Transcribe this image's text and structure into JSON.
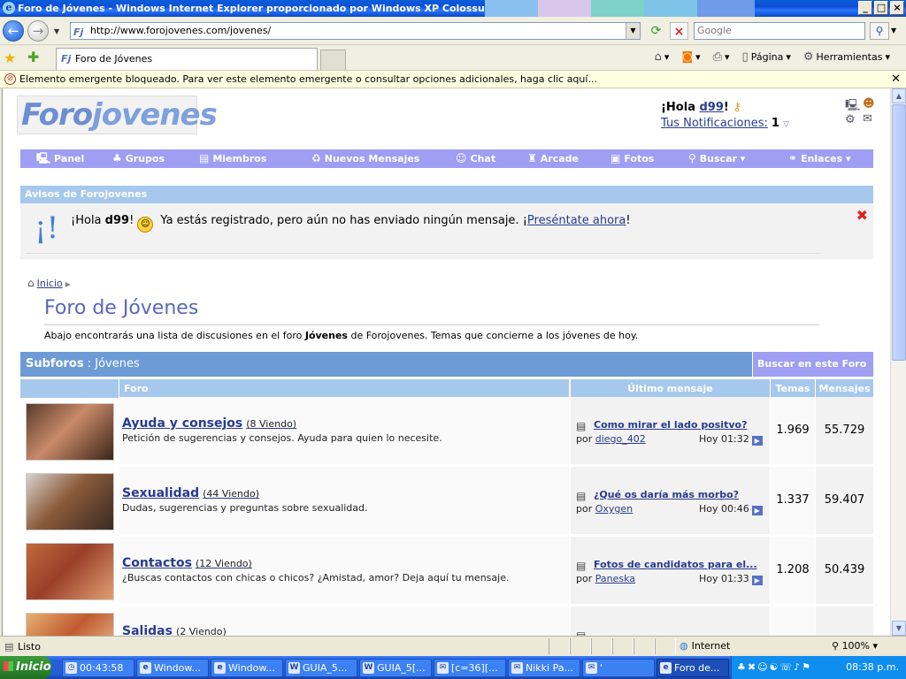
{
  "window": {
    "title": "Foro de Jóvenes - Windows Internet Explorer proporcionado por Windows XP Colossus Ed.",
    "controls": [
      "_",
      "□",
      "×"
    ]
  },
  "browser": {
    "url": "http://www.forojovenes.com/jovenes/",
    "search_placeholder": "Google",
    "tab_title": "Foro de Jóvenes",
    "tools": {
      "page": "Página",
      "tools": "Herramientas"
    },
    "infobar": "Elemento emergente bloqueado. Para ver este elemento emergente o consultar opciones adicionales, haga clic aquí..."
  },
  "site": {
    "logo_a": "Foro",
    "logo_b": "jovenes",
    "greeting_prefix": "¡Hola ",
    "username": "d99",
    "greeting_suffix": "!",
    "notifications_label": "Tus Notificaciones:",
    "notifications_count": "1",
    "nav": [
      {
        "label": "Panel",
        "icon": "monitor-icon",
        "glyph": "🖳"
      },
      {
        "label": "Grupos",
        "icon": "group-icon",
        "glyph": "♣"
      },
      {
        "label": "Miembros",
        "icon": "members-icon",
        "glyph": "▤"
      },
      {
        "label": "Nuevos Mensajes",
        "icon": "new-messages-icon",
        "glyph": "♻"
      },
      {
        "label": "Chat",
        "icon": "chat-icon",
        "glyph": "☺"
      },
      {
        "label": "Arcade",
        "icon": "arcade-icon",
        "glyph": "♜"
      },
      {
        "label": "Fotos",
        "icon": "camera-icon",
        "glyph": "▣"
      },
      {
        "label": "Buscar ▾",
        "icon": "search-icon",
        "glyph": "⚲"
      },
      {
        "label": "Enlaces ▾",
        "icon": "link-icon",
        "glyph": "⚭"
      }
    ],
    "notice_header": "Avisos de Forojovenes",
    "notice": {
      "hello": "¡Hola ",
      "user": "d99",
      "after_user": "!",
      "text": " Ya estás registrado, pero aún no has enviado ningún mensaje. ¡",
      "link": "Preséntate ahora",
      "end": "!"
    },
    "breadcrumb": "Inicio",
    "forum_title": "Foro de Jóvenes",
    "forum_desc_pre": "Abajo encontrarás una lista de discusiones en el foro ",
    "forum_desc_bold": "Jóvenes",
    "forum_desc_post": " de Forojovenes. Temas que concierne a los jóvenes de hoy.",
    "subforos_label": "Subforos",
    "subforos_sep": " : ",
    "subforos_name": "Jóvenes",
    "search_forum": "Buscar en este Foro ▾",
    "columns": {
      "forum": "Foro",
      "last": "Último mensaje",
      "topics": "Temas",
      "posts": "Mensajes"
    },
    "forums": [
      {
        "name": "Ayuda y consejos",
        "viewing": "(8 Viendo)",
        "desc": "Petición de sugerencias y consejos. Ayuda para quien lo necesite.",
        "last_title": "Como mirar el lado positvo?",
        "by": "por ",
        "author": "diego_402",
        "when": "Hoy 01:32",
        "topics": "1.969",
        "posts": "55.729",
        "thumb": [
          "#5a3b2a",
          "#c98a6a",
          "#3b2418"
        ]
      },
      {
        "name": "Sexualidad",
        "viewing": "(44 Viendo)",
        "desc": "Dudas, sugerencias y preguntas sobre sexualidad.",
        "last_title": "¿Qué os daría más morbo?",
        "by": "por ",
        "author": "Oxygen",
        "when": "Hoy 00:46",
        "topics": "1.337",
        "posts": "59.407",
        "thumb": [
          "#d8d2cc",
          "#8a5a3a",
          "#3a2a22"
        ]
      },
      {
        "name": "Contactos",
        "viewing": "(12 Viendo)",
        "desc": "¿Buscas contactos con chicas o chicos? ¿Amistad, amor? Deja aquí tu mensaje.",
        "last_title": "Fotos de candidatos para el...",
        "by": "por ",
        "author": "Paneska",
        "when": "Hoy 01:33",
        "topics": "1.208",
        "posts": "50.439",
        "thumb": [
          "#c06a3c",
          "#9a3f2a",
          "#e0a070"
        ]
      },
      {
        "name": "Salidas",
        "viewing": "(2 Viendo)",
        "desc": "",
        "last_title": "",
        "by": "",
        "author": "",
        "when": "",
        "topics": "",
        "posts": "",
        "thumb": [
          "#e6b070",
          "#c05a30",
          "#f0d0a0"
        ]
      }
    ]
  },
  "status": {
    "text": "Listo",
    "zone": "Internet",
    "zoom": "100%"
  },
  "taskbar": {
    "start": "Inicio",
    "tasks": [
      "00:43:58",
      "Window...",
      "Window...",
      "GUIA_5...",
      "GUIA_5[...",
      "[c=36][...",
      "Nikki Pa...",
      "'",
      "Foro de..."
    ],
    "clock": "08:38 p.m."
  },
  "colors": {
    "nav": "#9e9ef3",
    "header": "#a6c8ec",
    "subforos": "#6d9bd6",
    "link": "#2a3b8f",
    "title": "#5a67b8"
  }
}
